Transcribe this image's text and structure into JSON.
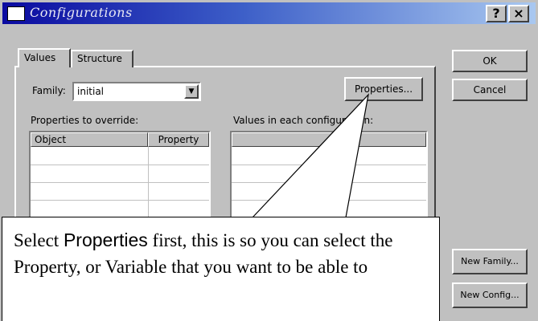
{
  "window": {
    "title": "Configurations",
    "help_label": "?",
    "close_label": "×"
  },
  "tabs": [
    {
      "label": "Values",
      "active": true
    },
    {
      "label": "Structure",
      "active": false
    }
  ],
  "family": {
    "label": "Family:",
    "value": "initial"
  },
  "buttons": {
    "properties": "Properties...",
    "ok": "OK",
    "cancel": "Cancel",
    "new_family": "New Family...",
    "new_config": "New Config..."
  },
  "properties_to_override": {
    "label": "Properties to override:",
    "columns": [
      "Object",
      "Property"
    ]
  },
  "values_in_each_config": {
    "label": "Values in each configuration:"
  },
  "callout": {
    "text_before": "Select ",
    "highlight": "Properties",
    "text_after": " first, this is so you can select the Property, or Variable that you want to be able to"
  }
}
